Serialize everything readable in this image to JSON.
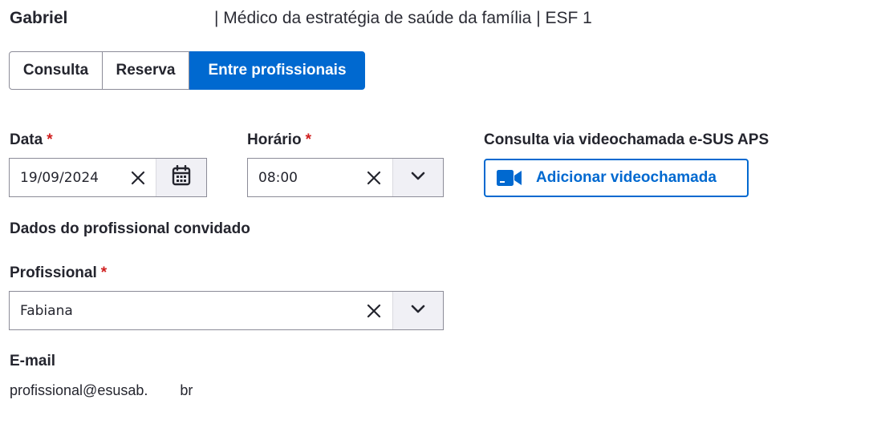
{
  "header": {
    "name": "Gabriel",
    "role": "| Médico da estratégia de saúde da família | ESF 1"
  },
  "tabs": [
    {
      "label": "Consulta",
      "active": false
    },
    {
      "label": "Reserva",
      "active": false
    },
    {
      "label": "Entre profissionais",
      "active": true
    }
  ],
  "date_field": {
    "label": "Data",
    "required_mark": "*",
    "value": "19/09/2024",
    "clear_icon": "close-icon",
    "calendar_icon": "calendar-icon"
  },
  "time_field": {
    "label": "Horário",
    "required_mark": "*",
    "value": "08:00",
    "clear_icon": "close-icon",
    "dropdown_icon": "chevron-down-icon"
  },
  "video": {
    "label": "Consulta via videochamada e-SUS APS",
    "button_label": "Adicionar videochamada",
    "button_icon": "video-camera-icon"
  },
  "invited": {
    "section_title": "Dados do profissional convidado",
    "professional_label": "Profissional",
    "required_mark": "*",
    "professional_value": "Fabiana",
    "email_label": "E-mail",
    "email_value": "profissional@esusab.        br"
  },
  "colors": {
    "primary": "#0069d0",
    "required": "#d01e1e",
    "border": "#8c8c98",
    "text": "#24252e"
  }
}
